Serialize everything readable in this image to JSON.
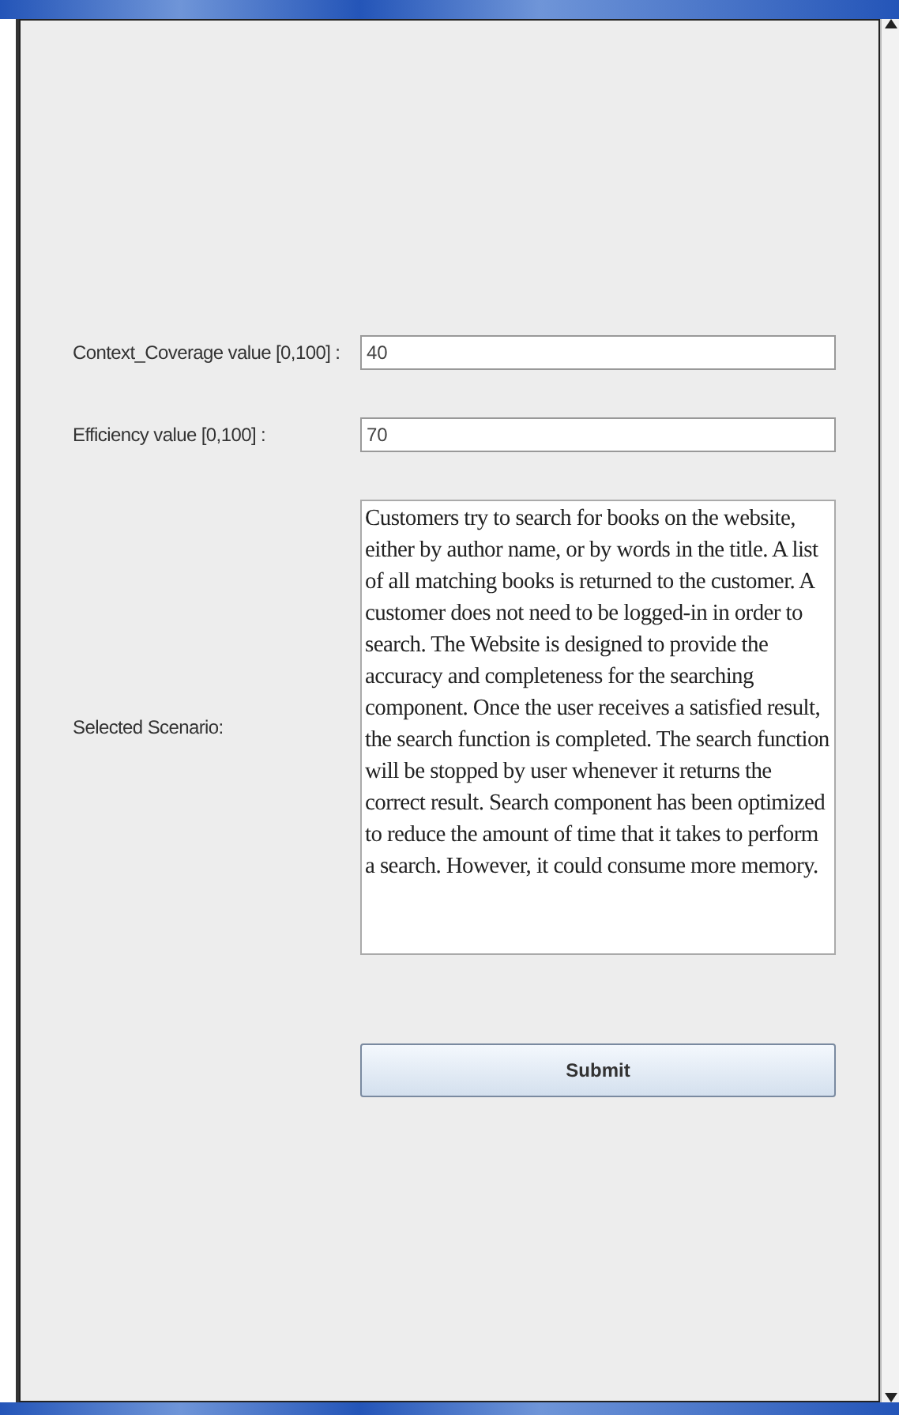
{
  "form": {
    "fields": [
      {
        "label": "Context_Coverage value [0,100] :",
        "value": "40"
      },
      {
        "label": "Efficiency value [0,100] :",
        "value": "70"
      }
    ],
    "scenario": {
      "label": "Selected Scenario:",
      "text": "Customers try to search for books on the website, either by author name, or by words in the title. A list of all matching books is returned to the customer. A customer does not need to be logged-in in order to search. The Website is designed to provide the accuracy and completeness for the searching component. Once the user receives a satisfied result, the search function is completed. The search function will be stopped by user whenever it returns the correct result.  Search component has been optimized to reduce the amount of time that it takes to perform a search. However, it could consume more memory."
    },
    "submit": "Submit"
  }
}
